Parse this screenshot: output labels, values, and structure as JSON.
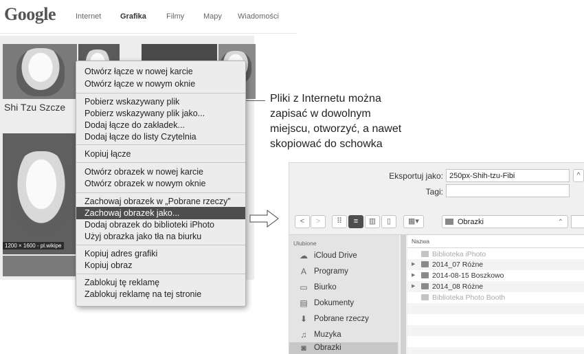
{
  "google": {
    "logo": "Google",
    "tabs": [
      {
        "label": "Internet"
      },
      {
        "label": "Grafika",
        "active": true
      },
      {
        "label": "Filmy"
      },
      {
        "label": "Mapy"
      },
      {
        "label": "Wiadomości"
      }
    ],
    "result_title": "Shi Tzu Szcze",
    "result_meta": "1200 × 1600 - pl.wikipe"
  },
  "context_menu": {
    "items": [
      "Otwórz łącze w nowej karcie",
      "Otwórz łącze w nowym oknie",
      "Pobierz wskazywany plik",
      "Pobierz wskazywany plik jako...",
      "Dodaj łącze do zakładek...",
      "Dodaj łącze do listy Czytelnia",
      "Kopiuj łącze",
      "Otwórz obrazek w nowej karcie",
      "Otwórz obrazek w nowym oknie",
      "Zachowaj obrazek w „Pobrane rzeczy”",
      "Zachowaj obrazek jako...",
      "Dodaj obrazek do biblioteki iPhoto",
      "Użyj obrazka jako tła na biurku",
      "Kopiuj adres grafiki",
      "Kopiuj obraz",
      "Zablokuj tę reklamę",
      "Zablokuj reklamę na tej stronie"
    ],
    "highlighted": "Zachowaj obrazek jako..."
  },
  "annotation": {
    "lines": [
      "Pliki z Internetu można",
      "zapisać w dowolnym",
      "miejscu, otworzyć, a nawet",
      "skopiować do schowka"
    ]
  },
  "save_dialog": {
    "export_label": "Eksportuj jako:",
    "export_value": "250px-Shih-tzu-Fibi",
    "tags_label": "Tagi:",
    "tags_value": "",
    "location": "Obrazki",
    "sidebar_heading": "Ulubione",
    "sidebar_items": [
      {
        "label": "iCloud Drive",
        "icon": "cloud-icon"
      },
      {
        "label": "Programy",
        "icon": "apps-icon"
      },
      {
        "label": "Biurko",
        "icon": "desktop-icon"
      },
      {
        "label": "Dokumenty",
        "icon": "documents-icon"
      },
      {
        "label": "Pobrane rzeczy",
        "icon": "download-icon"
      },
      {
        "label": "Muzyka",
        "icon": "music-icon"
      },
      {
        "label": "Obrazki",
        "icon": "camera-icon",
        "selected": true
      }
    ],
    "column_header": "Nazwa",
    "files": [
      {
        "label": "Biblioteka iPhoto",
        "disabled": true,
        "expandable": false
      },
      {
        "label": "2014_07 Różne",
        "disabled": false,
        "expandable": true
      },
      {
        "label": "2014-08-15 Boszkowo",
        "disabled": false,
        "expandable": true
      },
      {
        "label": "2014_08 Różne",
        "disabled": false,
        "expandable": true
      },
      {
        "label": "Biblioteka Photo Booth",
        "disabled": true,
        "expandable": false
      }
    ]
  }
}
